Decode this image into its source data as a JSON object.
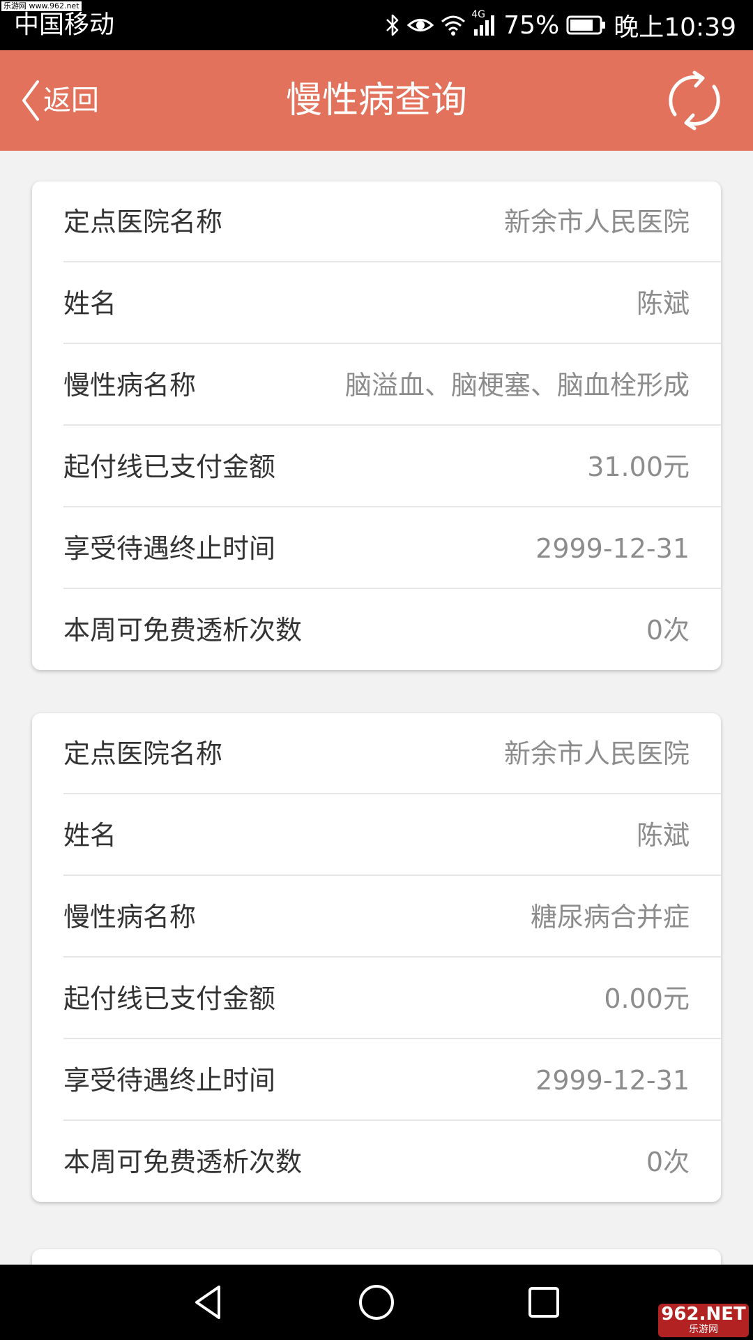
{
  "status_bar": {
    "watermark": "乐游网 www.962.net",
    "carrier": "中国移动",
    "network": "4G",
    "battery": "75%",
    "time": "晚上10:39",
    "icons": [
      "bluetooth-icon",
      "eye-comfort-icon",
      "wifi-icon",
      "cellular-signal-icon",
      "battery-icon"
    ]
  },
  "header": {
    "back_label": "返回",
    "title": "慢性病查询",
    "icons": [
      "chevron-left-icon",
      "refresh-icon"
    ],
    "background_color": "#e2725b"
  },
  "records": [
    {
      "rows": [
        {
          "label": "定点医院名称",
          "value": "新余市人民医院"
        },
        {
          "label": "姓名",
          "value": "陈斌"
        },
        {
          "label": "慢性病名称",
          "value": "脑溢血、脑梗塞、脑血栓形成"
        },
        {
          "label": "起付线已支付金额",
          "value": "31.00元"
        },
        {
          "label": "享受待遇终止时间",
          "value": "2999-12-31"
        },
        {
          "label": "本周可免费透析次数",
          "value": "0次"
        }
      ]
    },
    {
      "rows": [
        {
          "label": "定点医院名称",
          "value": "新余市人民医院"
        },
        {
          "label": "姓名",
          "value": "陈斌"
        },
        {
          "label": "慢性病名称",
          "value": "糖尿病合并症"
        },
        {
          "label": "起付线已支付金额",
          "value": "0.00元"
        },
        {
          "label": "享受待遇终止时间",
          "value": "2999-12-31"
        },
        {
          "label": "本周可免费透析次数",
          "value": "0次"
        }
      ]
    }
  ],
  "nav_bar": {
    "icons": [
      "back-triangle-icon",
      "home-circle-icon",
      "recent-apps-square-icon"
    ]
  },
  "watermark_bottom": {
    "main": "962.NET",
    "sub": "乐游网"
  }
}
